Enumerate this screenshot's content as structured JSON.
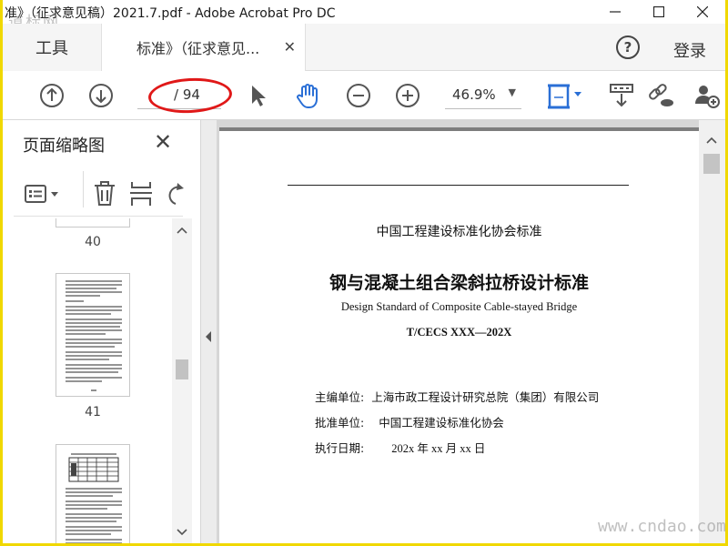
{
  "window": {
    "title": "准》（征求意见稿）2021.7.pdf - Adobe Acrobat Pro DC"
  },
  "tabs": {
    "tools_label": "工具",
    "doc_label": "标准》（征求意见...",
    "close_glyph": "✕"
  },
  "header": {
    "help_glyph": "?",
    "login_label": "登录"
  },
  "toolbar": {
    "page_total": "/ 94",
    "zoom_value": "46.9%"
  },
  "panel": {
    "title": "页面缩略图",
    "close_glyph": "✕",
    "thumbnails": [
      {
        "page": "40"
      },
      {
        "page": "41"
      }
    ]
  },
  "document": {
    "org_title": "中国工程建设标准化协会标准",
    "title_cn": "钢与混凝土组合梁斜拉桥设计标准",
    "title_en": "Design Standard of Composite Cable-stayed Bridge",
    "code": "T/CECS XXX—202X",
    "editor_label": "主编单位:",
    "editor_value": "上海市政工程设计研究总院（集团）有限公司",
    "approver_label": "批准单位:",
    "approver_value": "中国工程建设标准化协会",
    "date_label": "执行日期:",
    "date_value": "202x 年 xx 月 xx 日"
  },
  "watermarks": {
    "top_left": "道标网",
    "bottom_right": "www.cndao.com"
  },
  "colors": {
    "accent_blue": "#2a6fd6",
    "highlight_red": "#e01818",
    "frame_yellow": "#f0d800"
  }
}
